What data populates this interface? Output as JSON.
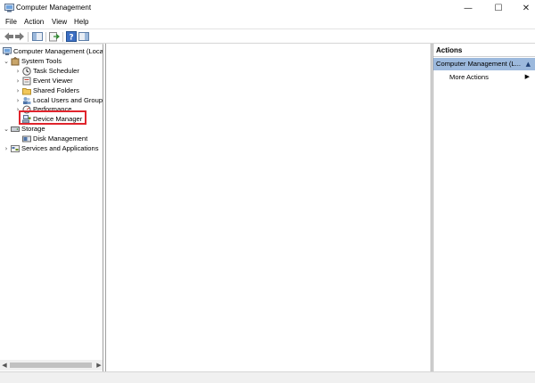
{
  "window": {
    "title": "Computer Management",
    "minimize_glyph": "—",
    "maximize_glyph": "☐",
    "close_glyph": "✕"
  },
  "menu": {
    "file": "File",
    "action": "Action",
    "view": "View",
    "help": "Help"
  },
  "toolbar": {
    "back_icon": "back-arrow",
    "forward_icon": "forward-arrow",
    "buttons": [
      "show-hide-console-tree",
      "export-list",
      "help",
      "show-hide-action-pane"
    ]
  },
  "tree": {
    "root": "Computer Management (Local",
    "system_tools": "System Tools",
    "task_scheduler": "Task Scheduler",
    "event_viewer": "Event Viewer",
    "shared_folders": "Shared Folders",
    "local_users": "Local Users and Groups",
    "performance": "Performance",
    "device_manager": "Device Manager",
    "storage": "Storage",
    "disk_management": "Disk Management",
    "services": "Services and Applications",
    "selected": "Device Manager"
  },
  "actions": {
    "header": "Actions",
    "section": "Computer Management (L...",
    "more_actions": "More Actions"
  },
  "colors": {
    "highlight_border": "#e0242c",
    "actions_section_bg": "#9cb9dd"
  }
}
